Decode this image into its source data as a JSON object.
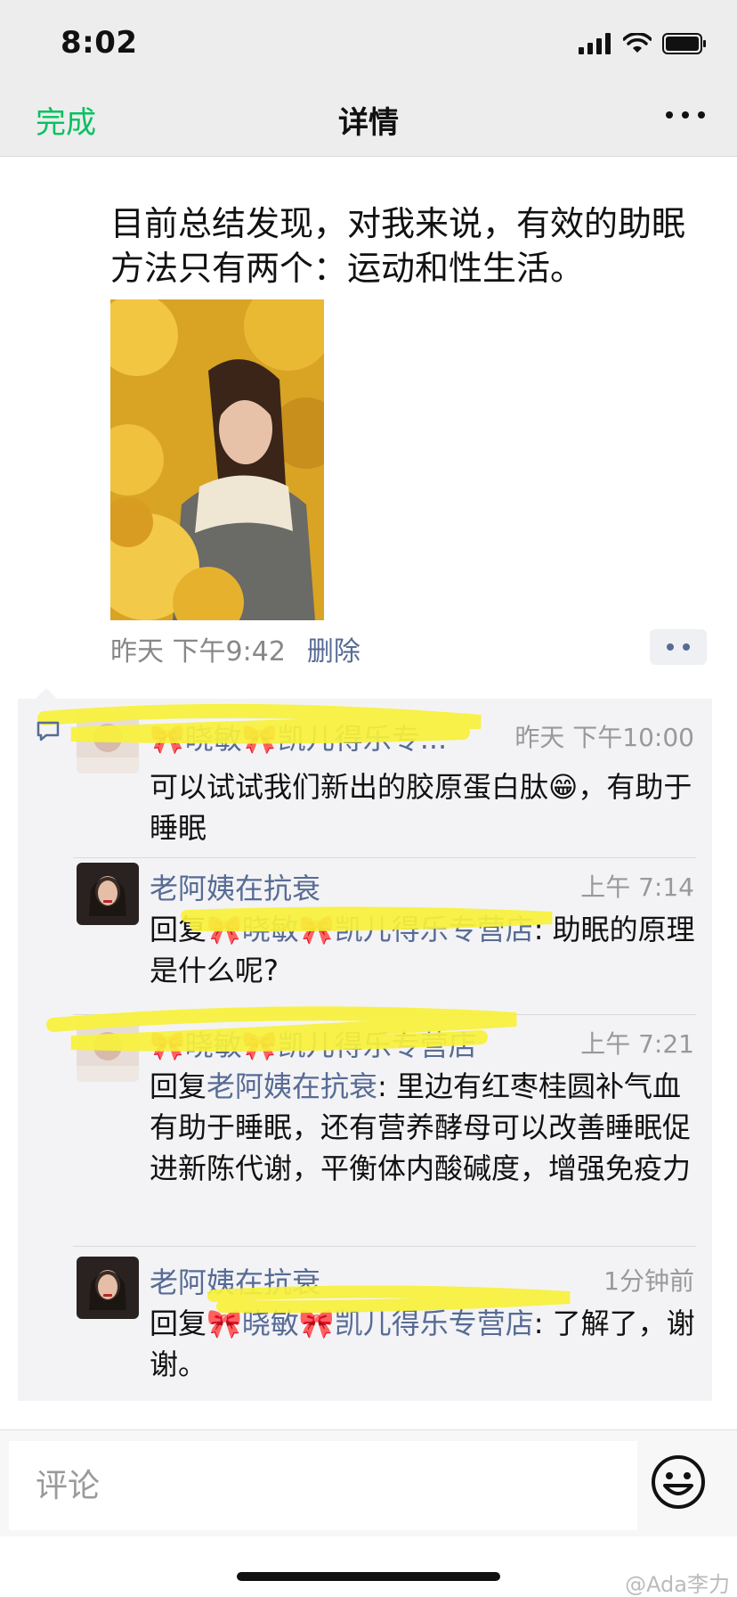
{
  "status_bar": {
    "time": "8:02"
  },
  "nav": {
    "done": "完成",
    "title": "详情"
  },
  "post": {
    "text": "目前总结发现，对我来说，有效的助眠方法只有两个：运动和性生活。",
    "time": "昨天 下午9:42",
    "delete": "删除"
  },
  "comments": [
    {
      "name": "🎀晓敏🎀凯儿得乐专...",
      "time": "昨天 下午10:00",
      "text": "可以试试我们新出的胶原蛋白肽😁，有助于睡眠",
      "reply_prefix": "",
      "reply_to": "",
      "reply_sep": ""
    },
    {
      "name": "老阿姨在抗衰",
      "time": "上午 7:14",
      "reply_prefix": "回复",
      "reply_to": "🎀晓敏🎀凯儿得乐专营店",
      "reply_sep": ": ",
      "text": "助眠的原理是什么呢?"
    },
    {
      "name": "🎀晓敏🎀凯儿得乐专营店",
      "time": "上午 7:21",
      "reply_prefix": "回复",
      "reply_to": "老阿姨在抗衰",
      "reply_sep": ": ",
      "text": "里边有红枣桂圆补气血有助于睡眠，还有营养酵母可以改善睡眠促进新陈代谢，平衡体内酸碱度，增强免疫力"
    },
    {
      "name": "老阿姨在抗衰",
      "time": "1分钟前",
      "reply_prefix": "回复",
      "reply_to": "🎀晓敏🎀凯儿得乐专营店",
      "reply_sep": ": ",
      "text": "了解了，谢谢。"
    }
  ],
  "comment_input": {
    "placeholder": "评论"
  },
  "watermark": "@Ada李力",
  "colors": {
    "accent_green": "#07c160",
    "link_blue": "#576b95",
    "highlight_yellow": "#f7f13a"
  },
  "icons": [
    "signal-icon",
    "wifi-icon",
    "battery-icon",
    "more-icon",
    "comment-icon",
    "emoji-icon"
  ]
}
